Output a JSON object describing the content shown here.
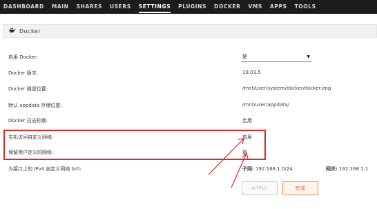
{
  "nav": {
    "items": [
      "DASHBOARD",
      "MAIN",
      "SHARES",
      "USERS",
      "SETTINGS",
      "PLUGINS",
      "DOCKER",
      "VMS",
      "APPS",
      "TOOLS"
    ],
    "active": "SETTINGS"
  },
  "section": {
    "title": "Docker",
    "icon": "docker-whale-icon"
  },
  "rows": [
    {
      "label": "启用 Docker:",
      "value": "是"
    },
    {
      "label": "Docker 版本:",
      "value": "19.03.5"
    },
    {
      "label": "Docker 磁盘位置:",
      "value": "/mnt/user/system/docker/docker.img"
    },
    {
      "label": "默认 appdata 存储位置:",
      "value": "/mnt/user/appdata/"
    },
    {
      "label": "Docker 日志轮换:",
      "value": "启用"
    },
    {
      "label": "主机访问自定义网络:",
      "value": "启用"
    },
    {
      "label": "保留用户定义的网络:",
      "value": "是"
    }
  ],
  "network": {
    "label": "为接口上的 IPv4 自定义网络 br0:",
    "subnet_label": "子网:",
    "subnet_value": "192.168.1.0/24",
    "gateway_label": "网关:",
    "gateway_value": "192.168.1.1"
  },
  "buttons": {
    "apply": "APPLY",
    "done": "完成"
  },
  "colors": {
    "highlight": "#e02525",
    "accent": "#e8632a",
    "nav_bg": "#1c1c1c"
  }
}
